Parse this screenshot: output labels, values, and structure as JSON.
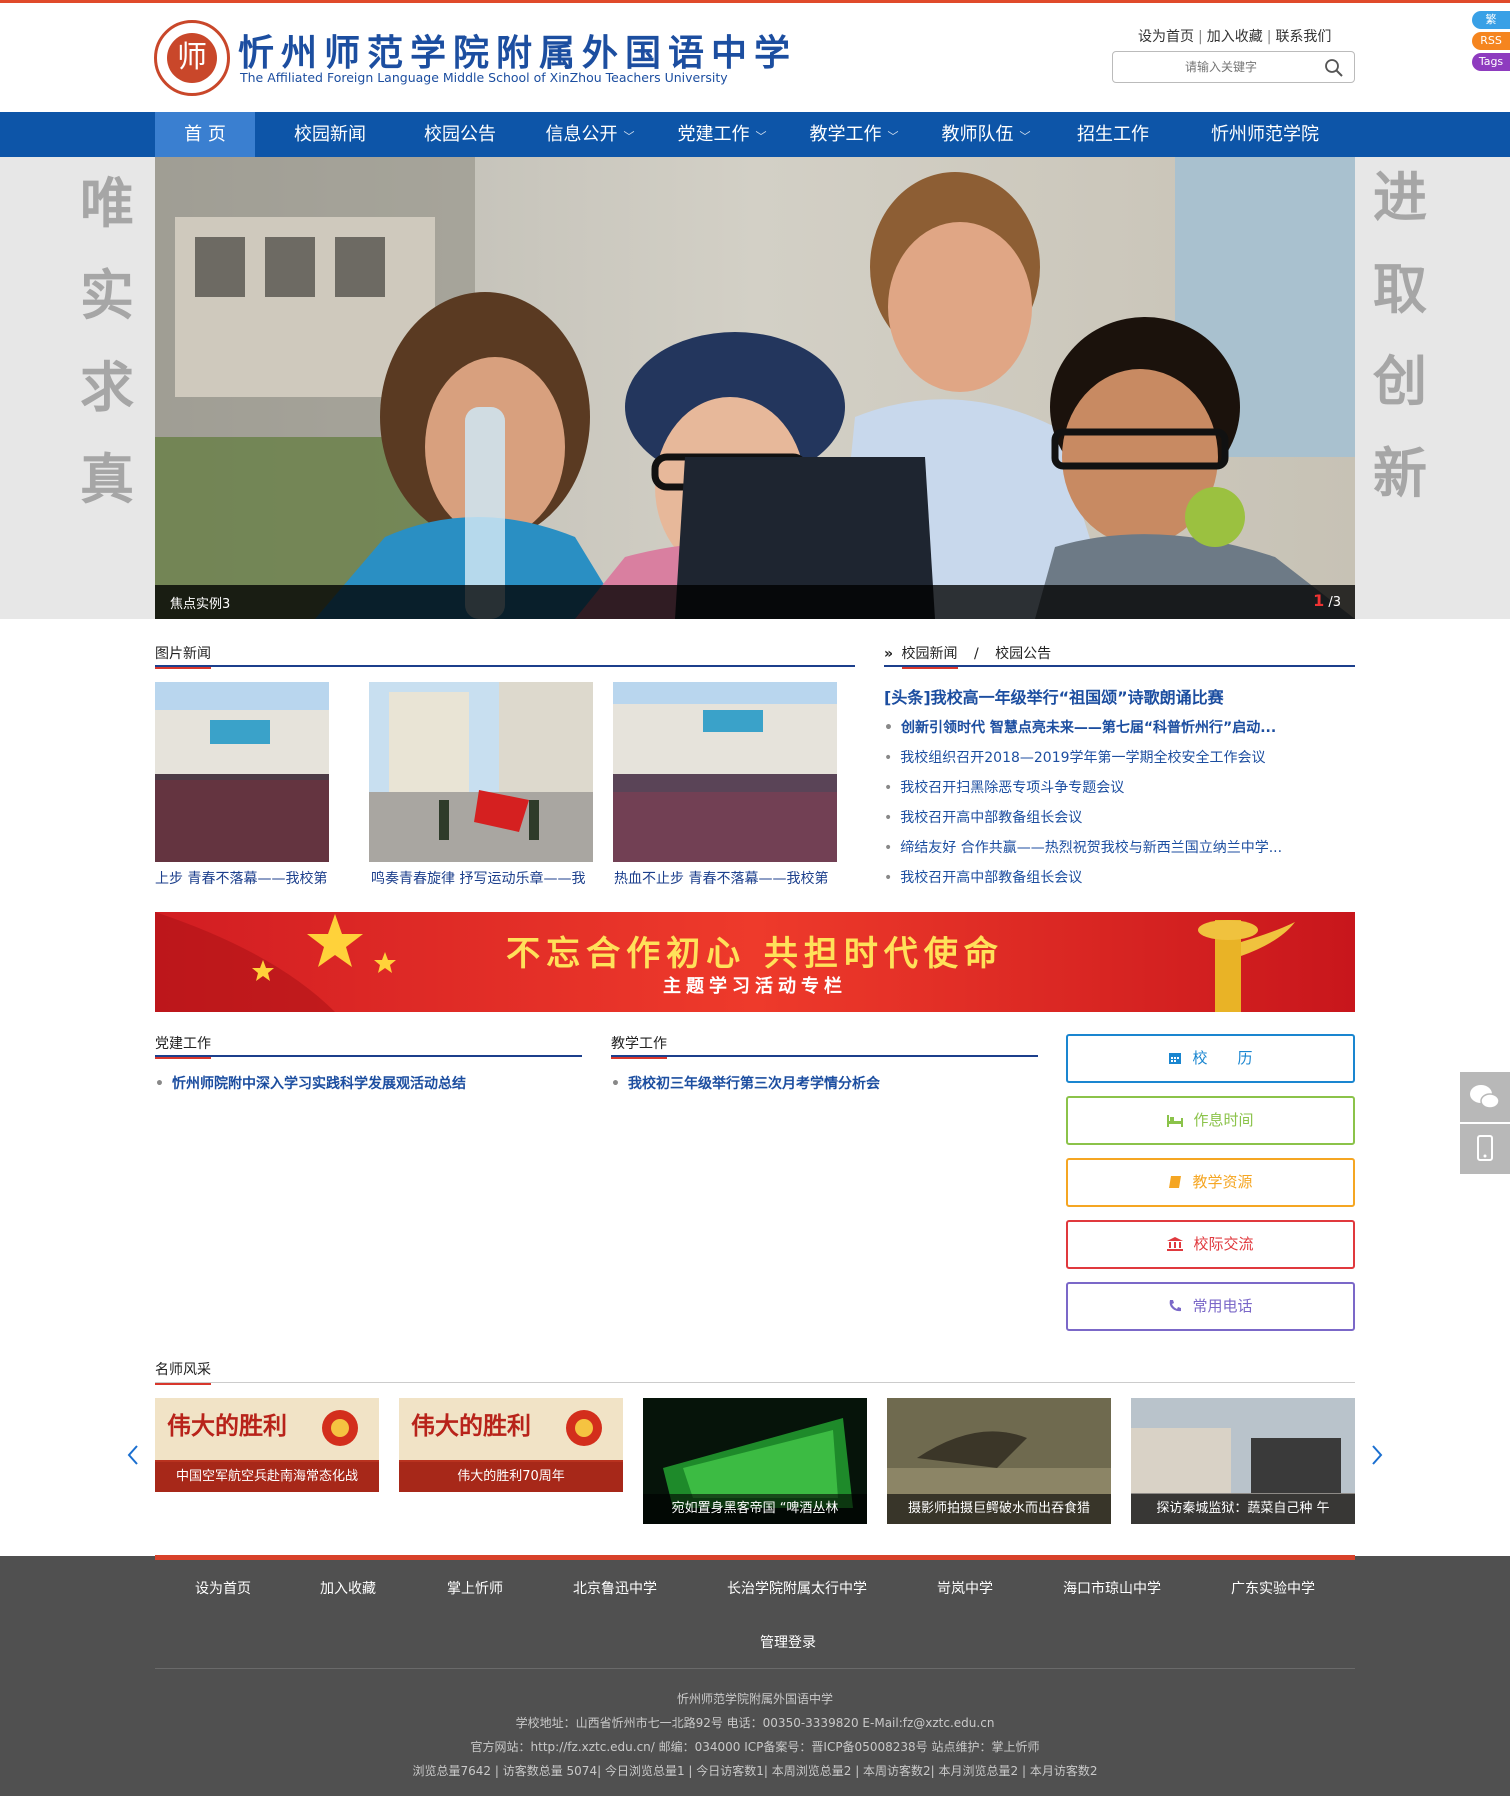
{
  "header": {
    "logo_cn": "忻州师范学院附属外国语中学",
    "logo_en": "The Affiliated Foreign Language Middle School of XinZhou Teachers University",
    "seal_char": "师",
    "top_links": [
      "设为首页",
      "加入收藏",
      "联系我们"
    ],
    "search_placeholder": "请输入关键字",
    "side_tags": [
      "繁",
      "RSS",
      "Tags"
    ]
  },
  "nav": {
    "items": [
      {
        "label": "首 页",
        "dropdown": false,
        "active": true
      },
      {
        "label": "校园新闻",
        "dropdown": false
      },
      {
        "label": "校园公告",
        "dropdown": false
      },
      {
        "label": "信息公开",
        "dropdown": true
      },
      {
        "label": "党建工作",
        "dropdown": true
      },
      {
        "label": "教学工作",
        "dropdown": true
      },
      {
        "label": "教师队伍",
        "dropdown": true
      },
      {
        "label": "招生工作",
        "dropdown": false
      },
      {
        "label": "忻州师范学院",
        "dropdown": false
      }
    ]
  },
  "banner": {
    "motto_left": [
      "唯",
      "实",
      "求",
      "真"
    ],
    "motto_right": [
      "进",
      "取",
      "创",
      "新"
    ],
    "caption": "焦点实例3",
    "current": "1",
    "total": "/3"
  },
  "picture_news": {
    "title": "图片新闻",
    "items": [
      {
        "caption": "上步 青春不落幕——我校第"
      },
      {
        "caption": "鸣奏青春旋律 抒写运动乐章——我"
      },
      {
        "caption": "热血不止步 青春不落幕——我校第"
      }
    ]
  },
  "news": {
    "tab1": "校园新闻",
    "sep": "/",
    "tab2": "校园公告",
    "headline": "[头条]我校高一年级举行“祖国颂”诗歌朗诵比赛",
    "items": [
      "创新引领时代 智慧点亮未来——第七届“科普忻州行”启动...",
      "我校组织召开2018—2019学年第一学期全校安全工作会议",
      "我校召开扫黑除恶专项斗争专题会议",
      "我校召开高中部教备组长会议",
      "缔结友好 合作共赢——热烈祝贺我校与新西兰国立纳兰中学...",
      "我校召开高中部教备组长会议"
    ]
  },
  "red_banner": {
    "title": "不忘合作初心 共担时代使命",
    "subtitle": "主题学习活动专栏"
  },
  "party": {
    "title": "党建工作",
    "items": [
      "忻州师院附中深入学习实践科学发展观活动总结"
    ]
  },
  "teaching": {
    "title": "教学工作",
    "items": [
      "我校初三年级举行第三次月考学情分析会"
    ]
  },
  "quick_links": [
    {
      "label": "校　　历",
      "icon": "calendar-icon",
      "color": "#1a86d0"
    },
    {
      "label": "作息时间",
      "icon": "bed-icon",
      "color": "#8bc34a"
    },
    {
      "label": "教学资源",
      "icon": "book-icon",
      "color": "#f5a623"
    },
    {
      "label": "校际交流",
      "icon": "bank-icon",
      "color": "#e0393e"
    },
    {
      "label": "常用电话",
      "icon": "phone-icon",
      "color": "#7b68c8"
    }
  ],
  "teachers": {
    "title": "名师风采",
    "items": [
      {
        "caption": "中国空军航空兵赴南海常态化战",
        "poster": "伟大的胜利"
      },
      {
        "caption": "伟大的胜利70周年",
        "poster": "伟大的胜利"
      },
      {
        "caption": "宛如置身黑客帝国 “啤酒丛林"
      },
      {
        "caption": "摄影师拍摄巨鳄破水而出吞食猎"
      },
      {
        "caption": "探访秦城监狱：蔬菜自己种 午"
      }
    ]
  },
  "footer": {
    "links": [
      "设为首页",
      "加入收藏",
      "掌上忻师",
      "北京鲁迅中学",
      "长治学院附属太行中学",
      "岢岚中学",
      "海口市琼山中学",
      "广东实验中学"
    ],
    "admin": "管理登录",
    "info": [
      "忻州师范学院附属外国语中学",
      "学校地址：山西省忻州市七一北路92号 电话：00350-3339820 E-Mail:fz@xztc.edu.cn",
      "官方网站：http://fz.xztc.edu.cn/ 邮编：034000 ICP备案号：晋ICP备05008238号 站点维护：掌上忻师",
      "浏览总量7642 | 访客数总量 5074| 今日浏览总量1 | 今日访客数1| 本周浏览总量2 | 本周访客数2| 本月浏览总量2 | 本月访客数2"
    ]
  }
}
